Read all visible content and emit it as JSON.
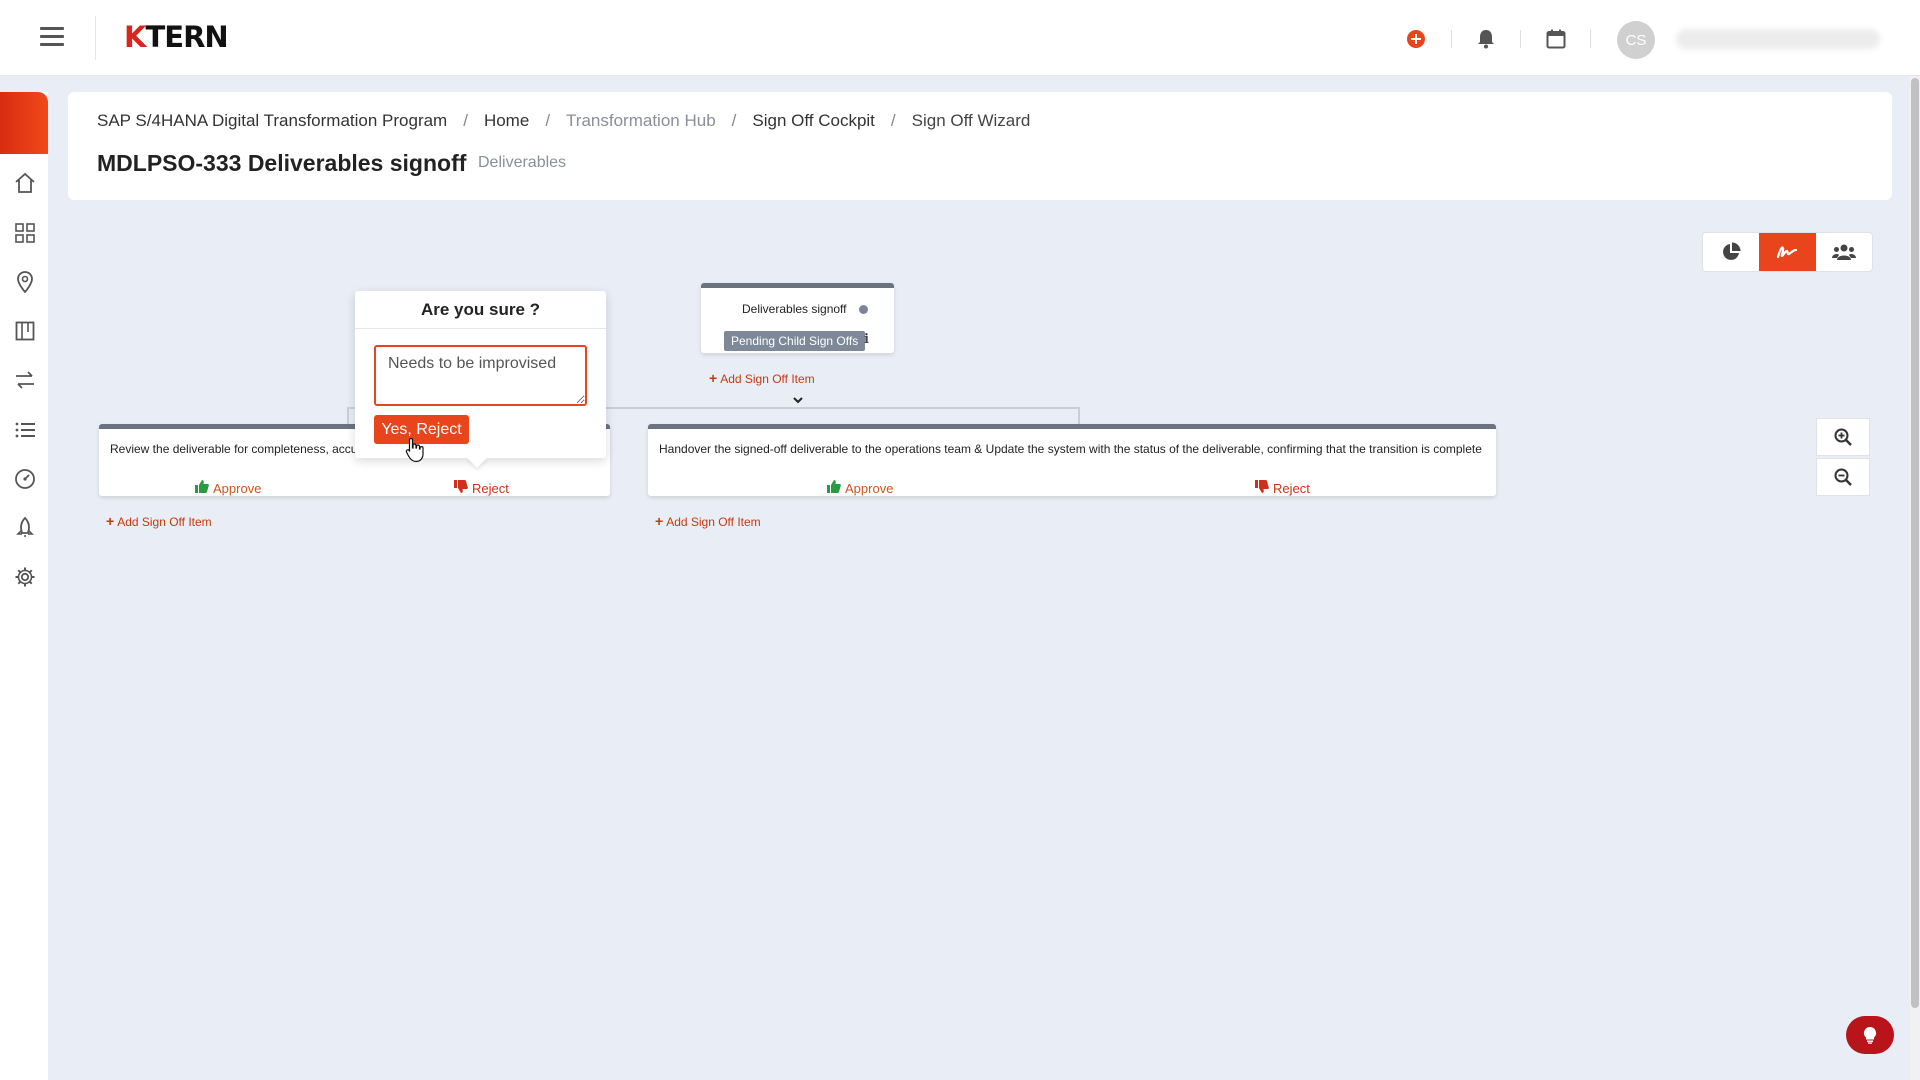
{
  "header": {
    "logo_text": "KTERN",
    "avatar_initials": "CS"
  },
  "breadcrumb": {
    "items": [
      {
        "label": "SAP S/4HANA Digital Transformation Program"
      },
      {
        "label": "Home"
      },
      {
        "label": "Transformation Hub"
      },
      {
        "label": "Sign Off Cockpit"
      },
      {
        "label": "Sign Off Wizard"
      }
    ],
    "separator": "/"
  },
  "page": {
    "title": "MDLPSO-333 Deliverables signoff",
    "subtitle": "Deliverables"
  },
  "top_node": {
    "title": "Deliverables signoff",
    "status_badge": "Pending Child Sign Offs",
    "info_icon": "i",
    "add_label": "Add Sign Off Item"
  },
  "child_nodes": [
    {
      "text": "Review the deliverable for completeness, accura",
      "approve_label": "Approve",
      "reject_label": "Reject",
      "add_label": "Add Sign Off Item"
    },
    {
      "text": "Handover the signed-off deliverable to the operations team & Update the system with the status of the deliverable, confirming that the transition is complete",
      "approve_label": "Approve",
      "reject_label": "Reject",
      "add_label": "Add Sign Off Item"
    }
  ],
  "confirm_popover": {
    "title": "Are you sure ?",
    "comment_value": "Needs to be improvised",
    "confirm_label": "Yes, Reject"
  },
  "view_toggle": {
    "active": "signoff-view",
    "options": [
      "pie-chart-icon",
      "signature-icon",
      "users-icon"
    ]
  },
  "colors": {
    "accent": "#e8451c",
    "brand_red": "#d7261e",
    "approve_green": "#2a9a43",
    "node_border": "#6b7380",
    "background": "#e9edf5"
  }
}
